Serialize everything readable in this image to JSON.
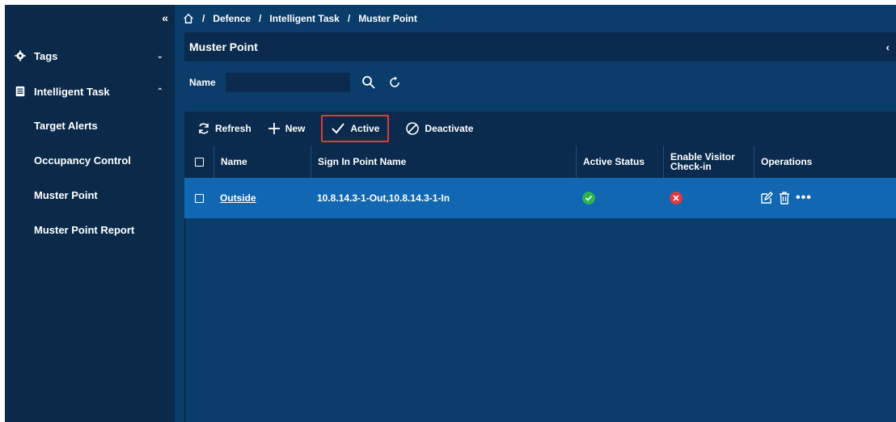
{
  "sidebar": {
    "collapse_icon": "double-chevron-left-icon",
    "groups": [
      {
        "label": "Tags",
        "icon": "gear-icon",
        "chevron": "chevron-down-icon"
      },
      {
        "label": "Intelligent Task",
        "icon": "clipboard-icon",
        "chevron": "chevron-up-icon"
      }
    ],
    "items": [
      {
        "label": "Target Alerts"
      },
      {
        "label": "Occupancy Control"
      },
      {
        "label": "Muster Point"
      },
      {
        "label": "Muster Point Report"
      }
    ]
  },
  "breadcrumb": {
    "home_icon": "home-icon",
    "separator": "/",
    "items": [
      "Defence",
      "Intelligent Task",
      "Muster Point"
    ]
  },
  "panel": {
    "title": "Muster Point",
    "collapse_arrow": "‹"
  },
  "search": {
    "label": "Name",
    "value": "",
    "placeholder": ""
  },
  "toolbar": {
    "refresh": "Refresh",
    "new": "New",
    "active": "Active",
    "deactivate": "Deactivate"
  },
  "table": {
    "headers": {
      "name": "Name",
      "sign_in_point": "Sign In Point Name",
      "active_status": "Active Status",
      "enable_visitor": "Enable Visitor Check-in",
      "operations": "Operations"
    },
    "rows": [
      {
        "name": "Outside",
        "sign_in_point": "10.8.14.3-1-Out,10.8.14.3-1-In",
        "active_status": "active",
        "enable_visitor": "disabled",
        "more": "•••"
      }
    ]
  },
  "colors": {
    "sidebar_bg": "#0b2a4a",
    "main_bg": "#0b3d6b",
    "row_selected": "#1167b1",
    "status_green": "#2fb351",
    "status_red": "#e0393e",
    "highlight_border": "#e53935"
  }
}
